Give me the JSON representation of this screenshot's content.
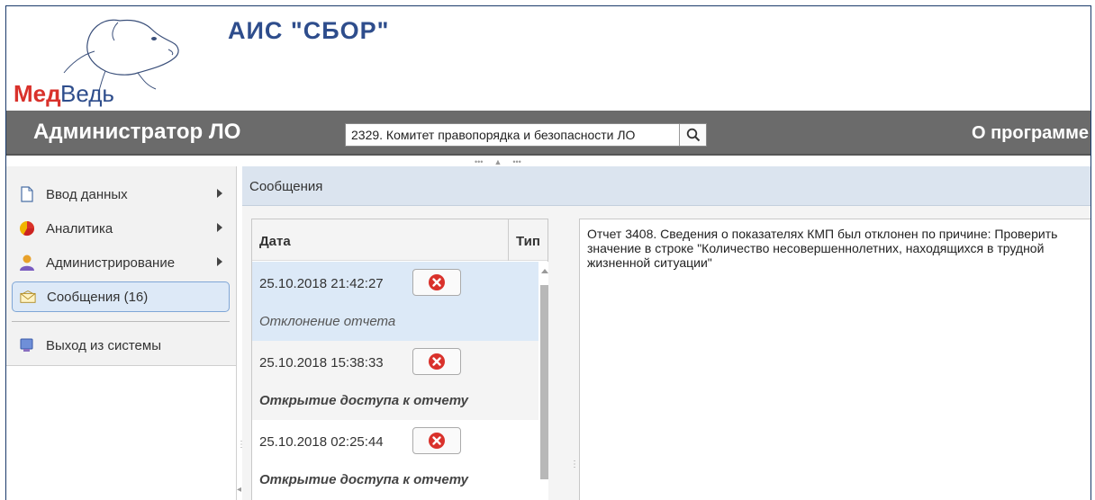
{
  "header": {
    "logo_text": "МедВедь",
    "app_title": "АИС \"СБОР\""
  },
  "toolbar": {
    "user_role": "Администратор ЛО",
    "org_value": "2329. Комитет правопорядка и безопасности ЛО",
    "about_label": "О программе"
  },
  "sidebar": {
    "items": [
      {
        "label": "Ввод данных",
        "icon": "document-icon",
        "has_submenu": true
      },
      {
        "label": "Аналитика",
        "icon": "pie-chart-icon",
        "has_submenu": true
      },
      {
        "label": "Администрирование",
        "icon": "user-icon",
        "has_submenu": true
      },
      {
        "label": "Сообщения (16)",
        "icon": "envelope-icon",
        "has_submenu": false,
        "active": true
      },
      {
        "label": "Выход из системы",
        "icon": "exit-icon",
        "has_submenu": false
      }
    ]
  },
  "content": {
    "title": "Сообщения"
  },
  "messages": {
    "columns": {
      "date": "Дата",
      "type": "Тип"
    },
    "rows": [
      {
        "date": "25.10.2018 21:42:27",
        "type": "Отклонение отчета",
        "selected": true
      },
      {
        "date": "25.10.2018 15:38:33",
        "type": "Открытие доступа к отчету",
        "selected": false
      },
      {
        "date": "25.10.2018 02:25:44",
        "type": "Открытие доступа к отчету",
        "selected": false
      }
    ]
  },
  "detail": {
    "text": "Отчет 3408. Сведения о показателях КМП был отклонен по причине: Проверить значение в строке \"Количество несовершеннолетних, находящихся в трудной жизненной ситуации\""
  },
  "colors": {
    "title_blue": "#2e4d8c",
    "band_gray": "#6b6b6b",
    "delete_red": "#d9312b",
    "selected_row": "#dce9f7"
  }
}
